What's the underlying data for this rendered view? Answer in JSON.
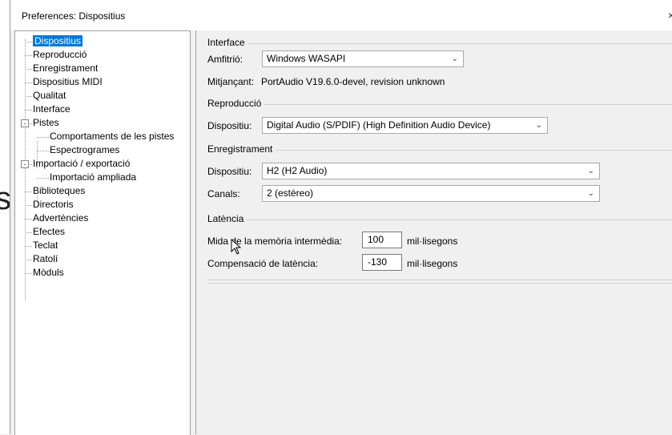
{
  "window": {
    "title": "Preferences: Dispositius",
    "close_glyph": "×"
  },
  "side_fragment": "s",
  "tree": [
    {
      "label": "Dispositius",
      "selected": true
    },
    {
      "label": "Reproducció"
    },
    {
      "label": "Enregistrament"
    },
    {
      "label": "Dispositius MIDI"
    },
    {
      "label": "Qualitat"
    },
    {
      "label": "Interface"
    },
    {
      "label": "Pistes",
      "expander": "-"
    },
    {
      "label": "Comportaments de les pistes"
    },
    {
      "label": "Espectrogrames"
    },
    {
      "label": "Importació / exportació",
      "expander": "-"
    },
    {
      "label": "Importació ampliada"
    },
    {
      "label": "Biblioteques"
    },
    {
      "label": "Directoris"
    },
    {
      "label": "Advertències"
    },
    {
      "label": "Efectes"
    },
    {
      "label": "Teclat"
    },
    {
      "label": "Ratolí"
    },
    {
      "label": "Mòduls"
    }
  ],
  "interface": {
    "title": "Interface",
    "host_label": "Amfitrió:",
    "host_value": "Windows WASAPI",
    "using_label": "Mitjançant:",
    "using_value": "PortAudio V19.6.0-devel, revision unknown"
  },
  "playback": {
    "title": "Reproducció",
    "device_label": "Dispositiu:",
    "device_value": "Digital Audio (S/PDIF) (High Definition Audio Device)"
  },
  "recording": {
    "title": "Enregistrament",
    "device_label": "Dispositiu:",
    "device_value": "H2 (H2 Audio)",
    "channels_label": "Canals:",
    "channels_value": "2 (estèreo)"
  },
  "latency": {
    "title": "Latència",
    "buffer_label": "Mida de la memòria intermèdia:",
    "buffer_value": "100",
    "buffer_unit": "mil·lisegons",
    "comp_label": "Compensació de latència:",
    "comp_value": "-130",
    "comp_unit": "mil·lisegons"
  },
  "icons": {
    "dropdown": "chevron-down-icon",
    "cursor": "mouse-pointer-icon"
  }
}
